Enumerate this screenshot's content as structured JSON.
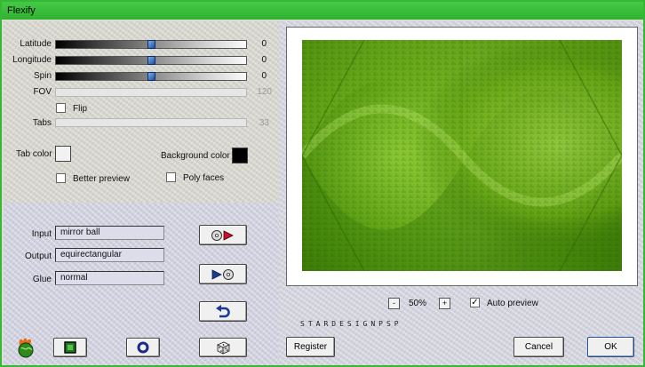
{
  "window": {
    "title": "Flexify"
  },
  "sliders": [
    {
      "label": "Latitude",
      "value": "0",
      "fraction": 0.5,
      "enabled": true
    },
    {
      "label": "Longitude",
      "value": "0",
      "fraction": 0.5,
      "enabled": true
    },
    {
      "label": "Spin",
      "value": "0",
      "fraction": 0.5,
      "enabled": true
    },
    {
      "label": "FOV",
      "value": "120",
      "enabled": false
    },
    {
      "label": "Tabs",
      "value": "33",
      "enabled": false
    }
  ],
  "options": {
    "flip_label": "Flip",
    "flip_checked": false,
    "better_preview_label": "Better preview",
    "better_preview_checked": false,
    "poly_faces_label": "Poly faces",
    "poly_faces_checked": false,
    "auto_preview_label": "Auto preview",
    "auto_preview_checked": true,
    "check_glyph": "✓"
  },
  "colors": {
    "tab_color_label": "Tab color",
    "tab_color": "#f2f2f2",
    "background_color_label": "Background color",
    "background_color": "#000000"
  },
  "projection": {
    "input_label": "Input",
    "input_value": "mirror ball",
    "output_label": "Output",
    "output_value": "equirectangular",
    "glue_label": "Glue",
    "glue_value": "normal"
  },
  "zoom": {
    "minus": "-",
    "plus": "+",
    "value": "50%"
  },
  "brand_text": "STARDESIGNPSP",
  "buttons": {
    "register": "Register",
    "cancel": "Cancel",
    "ok": "OK"
  }
}
